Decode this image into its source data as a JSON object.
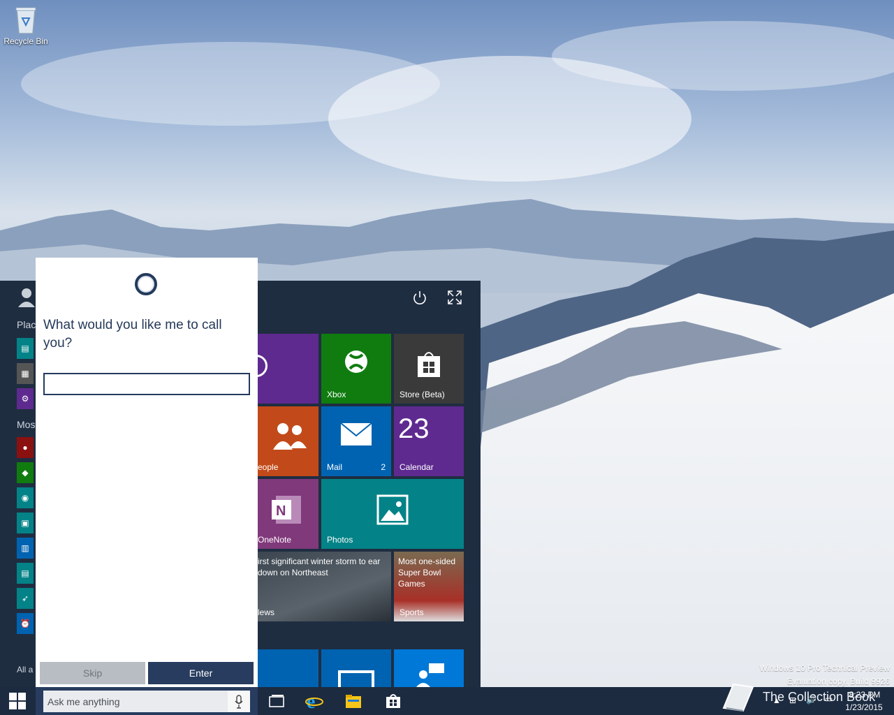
{
  "desktop": {
    "recycle_bin_label": "Recycle Bin",
    "watermark_line1": "Windows 10 Pro Technical Preview",
    "watermark_line2": "Evaluation copy. Build 9926",
    "overlay_brand": "The Collection Book"
  },
  "start_menu": {
    "places_label": "Plac",
    "most_used_label": "Mos",
    "all_apps_label": "All a",
    "tiles": {
      "xbox": "Xbox",
      "store": "Store (Beta)",
      "people": "eople",
      "mail": "Mail",
      "mail_count": "2",
      "calendar": "Calendar",
      "calendar_day": "23",
      "onenote": "OneNote",
      "photos": "Photos",
      "news_headline": "irst significant winter storm to ear down on Northeast",
      "news_label": "lews",
      "sports_headline": "Most one-sided Super Bowl Games",
      "sports_label": "Sports"
    },
    "colors": {
      "background": "#1f2d41",
      "purple": "#5e2a8f",
      "green": "#107c10",
      "gray": "#3a3a3a",
      "orange": "#c24a1a",
      "blue": "#0063b1",
      "teal": "#038387",
      "blue_tile": "#0078d7"
    }
  },
  "cortana": {
    "question": "What would you like me to call you?",
    "name_value": "",
    "skip_label": "Skip",
    "enter_label": "Enter",
    "accent": "#273c5e"
  },
  "taskbar": {
    "search_placeholder": "Ask me anything",
    "clock_time": "8:23 PM",
    "clock_date": "1/23/2015"
  }
}
